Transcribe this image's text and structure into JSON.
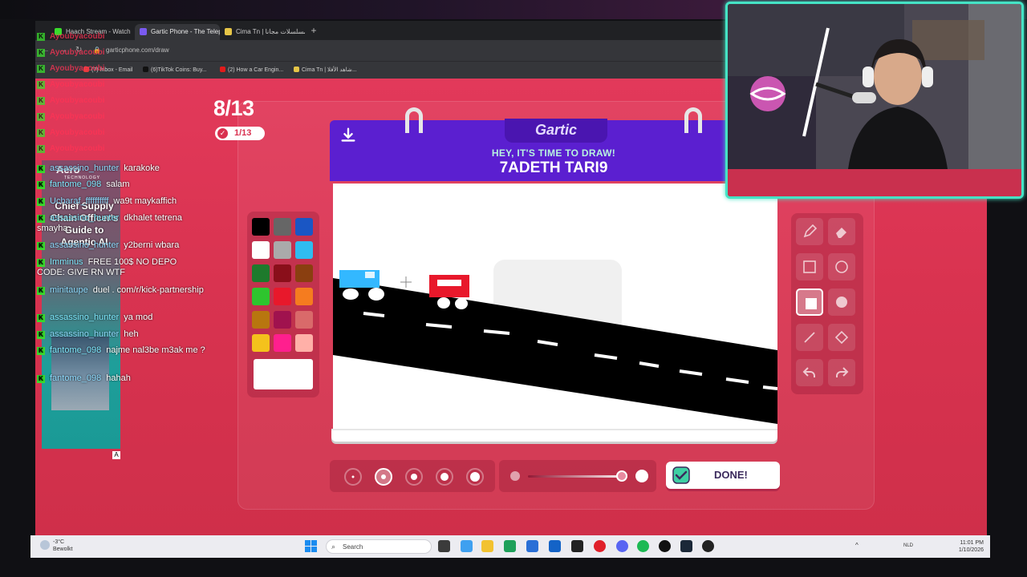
{
  "browser": {
    "tabs": [
      {
        "label": "Haach Stream - Watch",
        "color": "#3adc2c"
      },
      {
        "label": "Gartic Phone - The Telep",
        "color": "#7a5af0"
      },
      {
        "label": "Cima Tn | المسلسلات مجانا",
        "color": "#e6c547"
      }
    ],
    "new_tab": "+",
    "url": "garticphone.com/draw",
    "bookmarks": [
      "(7) Inbox - Email",
      "(6)TikTok Coins: Buy...",
      "(2) How a Car Engin...",
      "Cima Tn | شاهد الأفلا..."
    ]
  },
  "game": {
    "round": "8/13",
    "votes": "1/13",
    "title": "Gartic",
    "subtitle": "HEY, IT'S TIME TO DRAW!",
    "word": "7ADETH TARI9",
    "done_label": "DONE!",
    "palette": [
      "#000000",
      "#666666",
      "#1a56c4",
      "#ffffff",
      "#aaaaaa",
      "#2fbcf0",
      "#1e7a2c",
      "#8a0f1a",
      "#8a3f10",
      "#2ec52e",
      "#e8182b",
      "#f57c1f",
      "#b8760f",
      "#a0124e",
      "#d96a6a",
      "#f4c21c",
      "#ff1f8e",
      "#ffb0a8"
    ],
    "selected_color": "#ffffff",
    "colors": {
      "accent": "#5b1fd0",
      "background": "#d93a52",
      "subtitle": "#b8f2e0"
    }
  },
  "chat": [
    {
      "user": "assassino_hunter",
      "msg": "karakoke"
    },
    {
      "user": "fantome_098",
      "msg": "salam"
    },
    {
      "user": "Ucharaf_ffffffffff",
      "msg": "wa9t maykaffich"
    },
    {
      "user": "assassino_hunter",
      "msg": "dkhalet tetrena smayha"
    },
    {
      "user": "assassino_hunter",
      "msg": "y2berni wbara"
    },
    {
      "user": "Imminus",
      "msg": "FREE 100$ NO DEPO CODE: GIVE RN WTF"
    },
    {
      "user": "minitaupe",
      "msg": "duel . com/r/kick-partnership"
    },
    {
      "user": "assassino_hunter",
      "msg": "ya mod"
    },
    {
      "user": "assassino_hunter",
      "msg": "heh"
    },
    {
      "user": "fantome_098",
      "msg": "najme nal3be m3ak me ?"
    },
    {
      "user": "fantome_098",
      "msg": "hahah"
    }
  ],
  "ghost_names": [
    "Ayoubyacoubi",
    "Ayoubyacoubi",
    "Ayoubyacoubi",
    "Ayoubyacoubi",
    "Ayoubyacoubi",
    "Ayoubyacoubi",
    "Ayoubyacoubi",
    "Ayoubyacoubi"
  ],
  "ad": {
    "logo": "Aero",
    "logo_sub": "TECHNOLOGY",
    "text": "Chief Supply Chain Officer's Guide to Agentic AI",
    "mark": "A"
  },
  "taskbar": {
    "weather_temp": "-3°C",
    "weather_desc": "Bewolkt",
    "search_placeholder": "Search",
    "lang": "NLD",
    "time": "11:01 PM",
    "date": "1/10/2026"
  }
}
